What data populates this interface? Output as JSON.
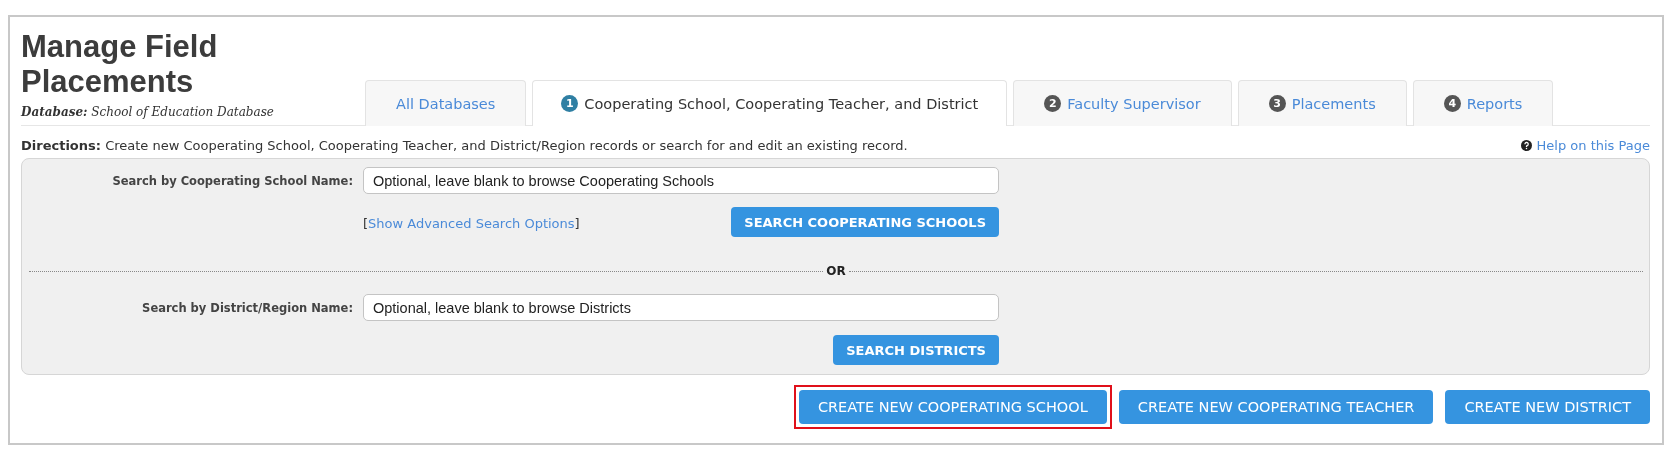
{
  "header": {
    "title": "Manage Field Placements",
    "database_label": "Database:",
    "database_name": "School of Education Database"
  },
  "tabs": [
    {
      "label": "All Databases",
      "selected": false
    },
    {
      "number": "1",
      "label": "Cooperating School, Cooperating Teacher, and District",
      "selected": true
    },
    {
      "number": "2",
      "label": "Faculty Supervisor",
      "selected": false
    },
    {
      "number": "3",
      "label": "Placements",
      "selected": false
    },
    {
      "number": "4",
      "label": "Reports",
      "selected": false
    }
  ],
  "directions": {
    "label": "Directions:",
    "text": "Create new Cooperating School, Cooperating Teacher, and District/Region records or search for and edit an existing record."
  },
  "help_link": "Help on this Page",
  "school_search": {
    "label": "Search by Cooperating School Name:",
    "placeholder": "Optional, leave blank to browse Cooperating Schools",
    "advanced_open": "[",
    "advanced_link": "Show Advanced Search Options",
    "advanced_close": "]",
    "button": "SEARCH COOPERATING SCHOOLS"
  },
  "separator": "OR",
  "district_search": {
    "label": "Search by District/Region Name:",
    "placeholder": "Optional, leave blank to browse Districts",
    "button": "SEARCH DISTRICTS"
  },
  "create_buttons": [
    {
      "label": "CREATE NEW COOPERATING SCHOOL",
      "highlighted": true
    },
    {
      "label": "CREATE NEW COOPERATING TEACHER",
      "highlighted": false
    },
    {
      "label": "CREATE NEW DISTRICT",
      "highlighted": false
    }
  ]
}
